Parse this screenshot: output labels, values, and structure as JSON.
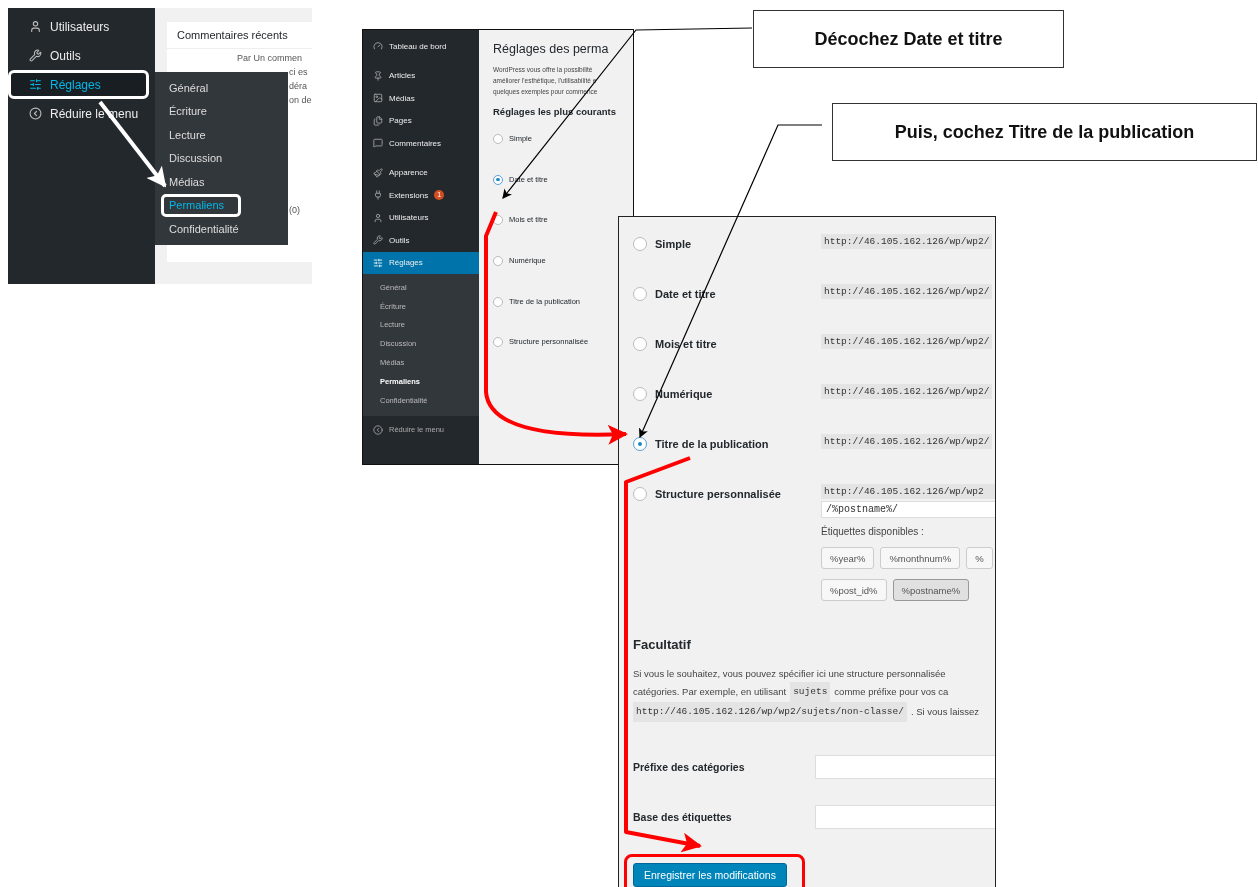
{
  "menu_screenshot": {
    "sidebar_items": [
      {
        "label": "Utilisateurs",
        "selected": false
      },
      {
        "label": "Outils",
        "selected": false
      },
      {
        "label": "Réglages",
        "selected": true
      },
      {
        "label": "Réduire le menu",
        "selected": false
      }
    ],
    "flyout_items": [
      {
        "label": "Général",
        "selected": false
      },
      {
        "label": "Écriture",
        "selected": false
      },
      {
        "label": "Lecture",
        "selected": false
      },
      {
        "label": "Discussion",
        "selected": false
      },
      {
        "label": "Médias",
        "selected": false
      },
      {
        "label": "Permaliens",
        "selected": true
      },
      {
        "label": "Confidentialité",
        "selected": false
      }
    ],
    "card_title": "Commentaires récents",
    "background_fragments": [
      "Par Un commen",
      "ci es",
      "déra",
      "on de",
      "(0)"
    ]
  },
  "settings_screenshot": {
    "sidebar_items": [
      {
        "label": "Tableau de bord",
        "selected": false
      },
      {
        "label": "Articles",
        "selected": false
      },
      {
        "label": "Médias",
        "selected": false
      },
      {
        "label": "Pages",
        "selected": false
      },
      {
        "label": "Commentaires",
        "selected": false
      },
      {
        "label": "Apparence",
        "selected": false
      },
      {
        "label": "Extensions",
        "selected": false,
        "badge": "1"
      },
      {
        "label": "Utilisateurs",
        "selected": false
      },
      {
        "label": "Outils",
        "selected": false
      },
      {
        "label": "Réglages",
        "selected": true
      }
    ],
    "submenu_items": [
      {
        "label": "Général",
        "selected": false
      },
      {
        "label": "Écriture",
        "selected": false
      },
      {
        "label": "Lecture",
        "selected": false
      },
      {
        "label": "Discussion",
        "selected": false
      },
      {
        "label": "Médias",
        "selected": false
      },
      {
        "label": "Permaliens",
        "selected": true
      },
      {
        "label": "Confidentialité",
        "selected": false
      }
    ],
    "collapse_label": "Réduire le menu",
    "title": "Réglages des perma",
    "intro_lines": [
      "WordPress vous offre la possibilité",
      "améliorer l'esthétique, l'utilisabilité e",
      "quelques exemples pour commence"
    ],
    "section_heading": "Réglages les plus courants",
    "options": [
      {
        "label": "Simple",
        "selected": false
      },
      {
        "label": "Date et titre",
        "selected": true
      },
      {
        "label": "Mois et titre",
        "selected": false
      },
      {
        "label": "Numérique",
        "selected": false
      },
      {
        "label": "Titre de la publication",
        "selected": false
      },
      {
        "label": "Structure personnalisée",
        "selected": false
      }
    ]
  },
  "detail_screenshot": {
    "options": [
      {
        "label": "Simple",
        "selected": false,
        "url": "http://46.105.162.126/wp/wp2/"
      },
      {
        "label": "Date et titre",
        "selected": false,
        "url": "http://46.105.162.126/wp/wp2/"
      },
      {
        "label": "Mois et titre",
        "selected": false,
        "url": "http://46.105.162.126/wp/wp2/"
      },
      {
        "label": "Numérique",
        "selected": false,
        "url": "http://46.105.162.126/wp/wp2/"
      },
      {
        "label": "Titre de la publication",
        "selected": true,
        "url": "http://46.105.162.126/wp/wp2/"
      },
      {
        "label": "Structure personnalisée",
        "selected": false,
        "url": "http://46.105.162.126/wp/wp2",
        "value": "/%postname%/"
      }
    ],
    "tags_label": "Étiquettes disponibles :",
    "tag_rows": [
      [
        {
          "label": "%year%",
          "selected": false
        },
        {
          "label": "%monthnum%",
          "selected": false
        },
        {
          "label": "%",
          "selected": false
        }
      ],
      [
        {
          "label": "%post_id%",
          "selected": false
        },
        {
          "label": "%postname%",
          "selected": true
        }
      ]
    ],
    "optional_heading": "Facultatif",
    "optional_lines": [
      [
        {
          "kind": "text",
          "text": "Si vous le souhaitez, vous pouvez spécifier ici une structure personnalisée"
        }
      ],
      [
        {
          "kind": "text",
          "text": "catégories. Par exemple, en utilisant"
        },
        {
          "kind": "code",
          "text": "sujets"
        },
        {
          "kind": "text",
          "text": "comme préfixe pour vos ca"
        }
      ],
      [
        {
          "kind": "code",
          "text": "http://46.105.162.126/wp/wp2/sujets/non-classe/"
        },
        {
          "kind": "text",
          "text": ". Si vous laissez"
        }
      ]
    ],
    "fields": [
      {
        "label": "Préfixe des catégories"
      },
      {
        "label": "Base des étiquettes"
      }
    ],
    "save_button": "Enregistrer les modifications"
  },
  "callouts": [
    {
      "text": "Décochez Date et titre"
    },
    {
      "text": "Puis, cochez Titre de la publication"
    }
  ]
}
